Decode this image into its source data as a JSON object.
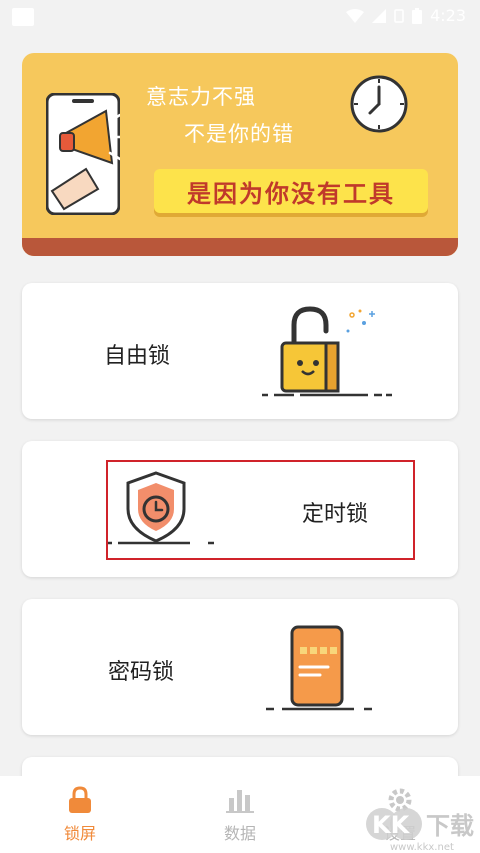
{
  "status_bar": {
    "time": "4:23"
  },
  "banner": {
    "line1": "意志力不强",
    "line2": "不是你的错",
    "slogan": "是因为你没有工具"
  },
  "cards": [
    {
      "label": "自由锁"
    },
    {
      "label": "定时锁"
    },
    {
      "label": "密码锁"
    }
  ],
  "tabs": [
    {
      "label": "锁屏",
      "active": true
    },
    {
      "label": "数据",
      "active": false
    },
    {
      "label": "设置",
      "active": false
    }
  ],
  "watermark": {
    "text": "KK下载",
    "url": "www.kkx.net"
  },
  "colors": {
    "accent": "#f08a3a",
    "banner_bg": "#f6c85c",
    "highlight": "#d0232a",
    "inactive": "#b5b5b5"
  }
}
